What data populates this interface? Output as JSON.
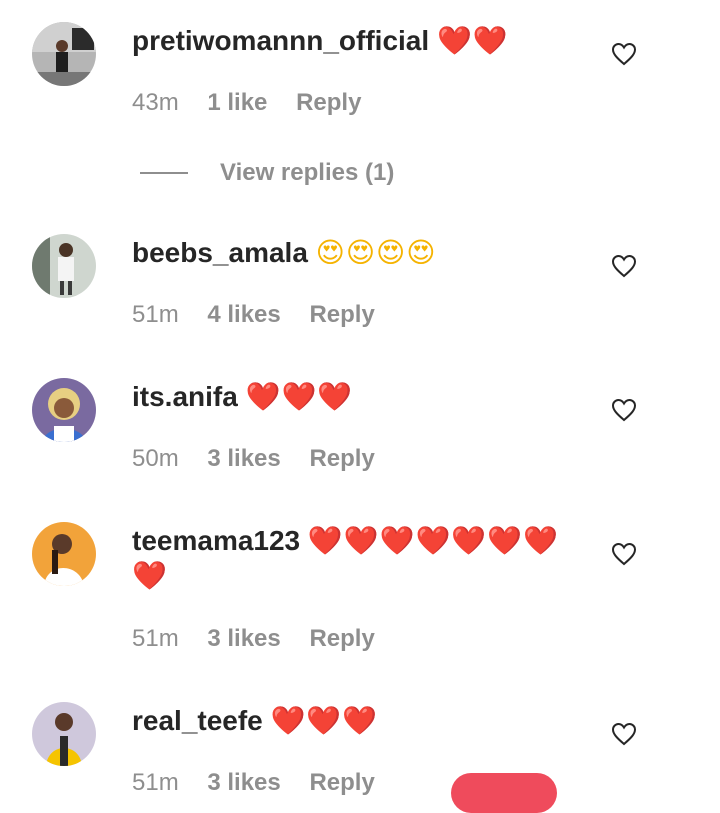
{
  "comments": [
    {
      "username": "pretiwomannn_official",
      "emoji": "❤️❤️",
      "emoji_type": "red",
      "time": "43m",
      "likes": "1 like",
      "reply": "Reply",
      "avatar_colors": [
        "#a8a8a8",
        "#3a3a3a"
      ]
    },
    {
      "username": "beebs_amala",
      "emoji": "😍😍😍😍",
      "emoji_type": "face",
      "time": "51m",
      "likes": "4 likes",
      "reply": "Reply",
      "avatar_colors": [
        "#9aa39a",
        "#f2f2f2"
      ]
    },
    {
      "username": "its.anifa",
      "emoji": "❤️❤️❤️",
      "emoji_type": "red",
      "time": "50m",
      "likes": "3 likes",
      "reply": "Reply",
      "avatar_colors": [
        "#6a4d8c",
        "#e8d28a"
      ]
    },
    {
      "username": "teemama123",
      "emoji": "❤️❤️❤️❤️❤️❤️❤️",
      "emoji2": "❤️",
      "emoji_type": "red",
      "time": "51m",
      "likes": "3 likes",
      "reply": "Reply",
      "avatar_colors": [
        "#f2a33a",
        "#ffffff"
      ]
    },
    {
      "username": "real_teefe",
      "emoji": "❤️❤️❤️",
      "emoji_type": "red",
      "time": "51m",
      "likes": "3 likes",
      "reply": "Reply",
      "avatar_colors": [
        "#c9c3d6",
        "#f5c400"
      ]
    }
  ],
  "view_replies": "View replies (1)",
  "colors": {
    "text": "#262626",
    "meta": "#8e8e8e",
    "heart_red": "#e0243a",
    "fab": "#ef4b5c"
  }
}
